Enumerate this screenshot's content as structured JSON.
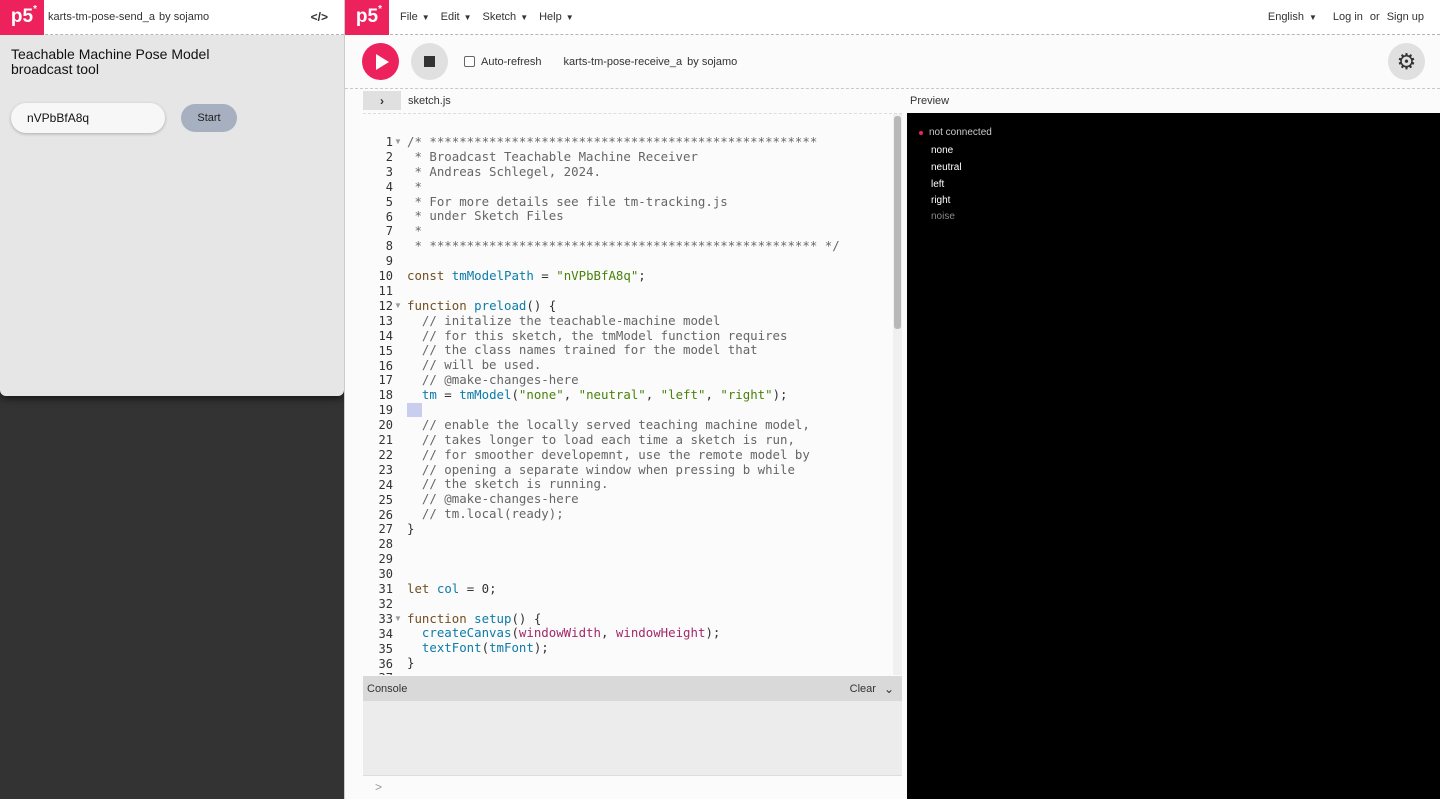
{
  "left_window": {
    "sketch_title": "karts-tm-pose-send_a",
    "by_label": "by",
    "author": "sojamo",
    "code_toggle": "</>",
    "app_title_line1": "Teachable Machine Pose Model",
    "app_title_line2": "broadcast tool",
    "model_input_value": "nVPbBfA8q",
    "start_label": "Start"
  },
  "editor": {
    "logo": "p5",
    "menu": [
      "File",
      "Edit",
      "Sketch",
      "Help"
    ],
    "language": "English",
    "login": "Log in",
    "or": "or",
    "signup": "Sign up",
    "auto_refresh": "Auto-refresh",
    "sketch_name": "karts-tm-pose-receive_a",
    "by_label": "by",
    "author": "sojamo",
    "file_tab": "sketch.js",
    "preview_label": "Preview",
    "console_title": "Console",
    "console_clear": "Clear",
    "console_prompt": ">"
  },
  "code": {
    "line_count": 37,
    "lines": [
      "/* ****************************************************",
      " * Broadcast Teachable Machine Receiver",
      " * Andreas Schlegel, 2024.",
      " *",
      " * For more details see file tm-tracking.js",
      " * under Sketch Files",
      " *",
      " * **************************************************** */",
      "",
      "const tmModelPath = \"nVPbBfA8q\";",
      "",
      "function preload() {",
      "  // initalize the teachable-machine model",
      "  // for this sketch, the tmModel function requires",
      "  // the class names trained for the model that",
      "  // will be used.",
      "  // @make-changes-here",
      "  tm = tmModel(\"none\", \"neutral\", \"left\", \"right\");",
      "",
      "  // enable the locally served teaching machine model,",
      "  // takes longer to load each time a sketch is run,",
      "  // for smoother developemnt, use the remote model by",
      "  // opening a separate window when pressing b while",
      "  // the sketch is running.",
      "  // @make-changes-here",
      "  // tm.local(ready);",
      "}",
      "",
      "",
      "",
      "let col = 0;",
      "",
      "function setup() {",
      "  createCanvas(windowWidth, windowHeight);",
      "  textFont(tmFont);",
      "}",
      ""
    ]
  },
  "preview": {
    "status": "not connected",
    "classes": [
      "none",
      "neutral",
      "left",
      "right",
      "noise"
    ]
  }
}
